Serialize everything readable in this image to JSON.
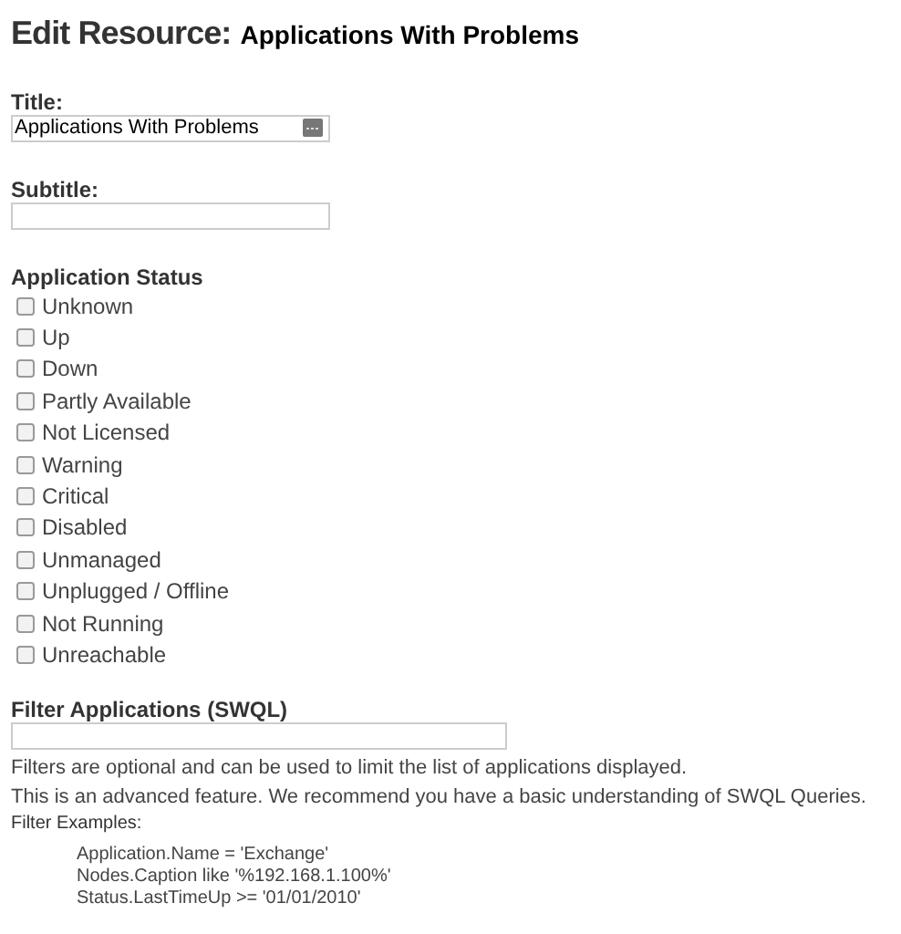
{
  "heading": {
    "prefix": "Edit Resource:",
    "resource": "Applications With Problems"
  },
  "title_field": {
    "label": "Title:",
    "value": "Applications With Problems"
  },
  "subtitle_field": {
    "label": "Subtitle:"
  },
  "application_status": {
    "label": "Application Status",
    "options": [
      {
        "label": "Unknown",
        "checked": false
      },
      {
        "label": "Up",
        "checked": false
      },
      {
        "label": "Down",
        "checked": false
      },
      {
        "label": "Partly Available",
        "checked": false
      },
      {
        "label": "Not Licensed",
        "checked": false
      },
      {
        "label": "Warning",
        "checked": false
      },
      {
        "label": "Critical",
        "checked": false
      },
      {
        "label": "Disabled",
        "checked": false
      },
      {
        "label": "Unmanaged",
        "checked": false
      },
      {
        "label": "Unplugged / Offline",
        "checked": false
      },
      {
        "label": "Not Running",
        "checked": false
      },
      {
        "label": "Unreachable",
        "checked": false
      }
    ]
  },
  "filter": {
    "label": "Filter Applications (SWQL)",
    "help": [
      "Filters are optional and can be used to limit the list of applications displayed.",
      "This is an advanced feature. We recommend you have a basic understanding of SWQL Queries."
    ],
    "examples_label": "Filter Examples:",
    "examples": [
      "Application.Name = 'Exchange'",
      "Nodes.Caption like '%192.168.1.100%'",
      "Status.LastTimeUp >= '01/01/2010'"
    ]
  }
}
